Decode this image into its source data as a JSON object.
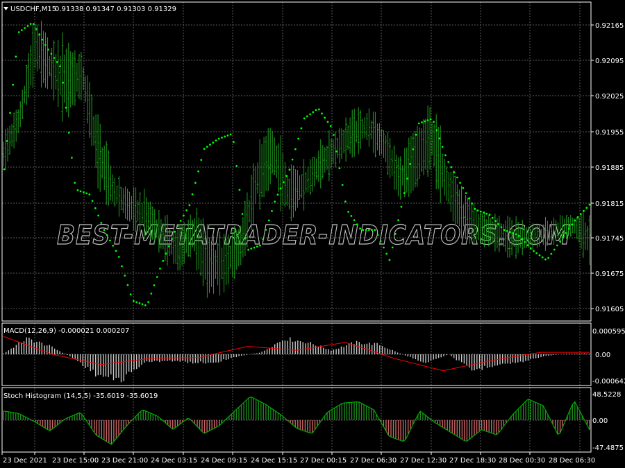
{
  "symbol_label": "USDCHF,M15",
  "ohlc_label": "0.91338 0.91347 0.91303 0.91329",
  "watermark": "BEST-METATRADER-INDICATORS.COM",
  "colors": {
    "background": "#000000",
    "grid": "#5a5a5a",
    "frame": "#ffffff",
    "candle": "#1fa31f",
    "sar": "#00ff00",
    "macd_hist": "#c8c8c8",
    "macd_signal": "#ff0000",
    "stoch_pos": "#1a8a1a",
    "stoch_neg": "#c86464",
    "stoch_line": "#00aa00"
  },
  "icons": {
    "symbol_dropdown": "triangle-down-icon"
  },
  "price_axis": [
    "0.92165",
    "0.92095",
    "0.92025",
    "0.91955",
    "0.91885",
    "0.91815",
    "0.91745",
    "0.91675",
    "0.91605"
  ],
  "macd": {
    "label": "MACD(12,26,9) -0.000021 0.000207",
    "axis": [
      "0.000595",
      "0.00",
      "-0.000642"
    ]
  },
  "stoch": {
    "label": "Stoch Histogram (14,5,5) -35.6019 -35.6019",
    "axis": [
      "48.5228",
      "0.00",
      "-47.4875"
    ]
  },
  "time_axis": [
    "23 Dec 2021",
    "23 Dec 15:00",
    "23 Dec 21:00",
    "24 Dec 03:15",
    "24 Dec 09:15",
    "24 Dec 15:15",
    "27 Dec 00:15",
    "27 Dec 06:30",
    "27 Dec 12:30",
    "27 Dec 18:30",
    "28 Dec 00:30",
    "28 Dec 06:30"
  ],
  "chart_data": {
    "type": "line",
    "price_key": [
      [
        0.9188,
        0.9194
      ],
      [
        0.9196,
        0.92
      ],
      [
        0.9208,
        0.9217
      ],
      [
        0.9205,
        0.9211
      ],
      [
        0.9199,
        0.9212
      ],
      [
        0.9204,
        0.9209
      ],
      [
        0.9186,
        0.9196
      ],
      [
        0.9181,
        0.9186
      ],
      [
        0.9178,
        0.9183
      ],
      [
        0.9176,
        0.9182
      ],
      [
        0.9172,
        0.9178
      ],
      [
        0.9169,
        0.9175
      ],
      [
        0.9172,
        0.9179
      ],
      [
        0.9164,
        0.9174
      ],
      [
        0.9166,
        0.9173
      ],
      [
        0.917,
        0.9176
      ],
      [
        0.9182,
        0.919
      ],
      [
        0.9187,
        0.9196
      ],
      [
        0.9178,
        0.9188
      ],
      [
        0.9182,
        0.9188
      ],
      [
        0.9186,
        0.9192
      ],
      [
        0.9189,
        0.9195
      ],
      [
        0.9192,
        0.9198
      ],
      [
        0.9194,
        0.9199
      ],
      [
        0.919,
        0.9196
      ],
      [
        0.9183,
        0.9189
      ],
      [
        0.9186,
        0.9194
      ],
      [
        0.919,
        0.9199
      ],
      [
        0.918,
        0.919
      ],
      [
        0.9176,
        0.9182
      ],
      [
        0.9174,
        0.9179
      ],
      [
        0.9173,
        0.9178
      ],
      [
        0.9172,
        0.9177
      ],
      [
        0.9172,
        0.9177
      ],
      [
        0.9173,
        0.9177
      ],
      [
        0.9174,
        0.9178
      ],
      [
        0.9175,
        0.9179
      ],
      [
        0.917,
        0.9178
      ]
    ],
    "sar_key": [
      [
        0.9188,
        0.9215
      ],
      [
        0.9217,
        0.9212
      ],
      [
        0.9208,
        0.9184
      ],
      [
        0.9183,
        0.9176
      ],
      [
        0.9171,
        0.9162
      ],
      [
        0.9161,
        0.9169
      ],
      [
        0.9176,
        0.9181
      ],
      [
        0.9192,
        0.9194
      ],
      [
        0.9195,
        0.9172
      ],
      [
        0.9173,
        0.9182
      ],
      [
        0.9188,
        0.9198
      ],
      [
        0.92,
        0.9196
      ],
      [
        0.918,
        0.9176
      ],
      [
        0.9176,
        0.917
      ],
      [
        0.9183,
        0.9197
      ],
      [
        0.9198,
        0.919
      ],
      [
        0.9185,
        0.918
      ],
      [
        0.9179,
        0.9176
      ],
      [
        0.9175,
        0.9172
      ],
      [
        0.917,
        0.9174
      ],
      [
        0.9178,
        0.9181
      ]
    ],
    "macd_key": [
      [
        2e-05,
        0.0004,
        0.00045
      ],
      [
        0.0002,
        -0.0001,
        0.0
      ],
      [
        -0.0005,
        -0.00063,
        -0.00025
      ],
      [
        -0.0002,
        -0.00015,
        -0.0001
      ],
      [
        -0.0002,
        -0.0002,
        -8e-05
      ],
      [
        -5e-05,
        5e-05,
        0.0002
      ],
      [
        0.0004,
        0.0003,
        0.0001
      ],
      [
        0.0001,
        0.0003,
        0.0003
      ],
      [
        0.00025,
        0.0,
        -0.0001
      ],
      [
        -0.0002,
        0.0,
        -0.0004
      ],
      [
        -0.0004,
        -0.00025,
        -0.00015
      ],
      [
        -0.0002,
        -5e-05,
        5e-05
      ],
      [
        2e-05,
        2e-05,
        5e-05
      ]
    ],
    "stoch_key": [
      [
        0.35,
        0.25,
        -0.05
      ],
      [
        -0.4,
        0.05,
        0.3
      ],
      [
        -0.55,
        -0.9,
        -0.2
      ],
      [
        0.4,
        0.15,
        -0.35
      ],
      [
        0.1,
        -0.5,
        -0.2
      ],
      [
        0.35,
        0.9,
        0.6
      ],
      [
        0.2,
        -0.3,
        -0.5
      ],
      [
        0.3,
        0.65,
        0.7
      ],
      [
        0.4,
        -0.6,
        -0.8
      ],
      [
        0.35,
        -0.1,
        -0.45
      ],
      [
        -0.8,
        -0.35,
        -0.55
      ],
      [
        0.2,
        0.8,
        0.55
      ],
      [
        -0.6,
        0.75,
        -0.36
      ]
    ]
  }
}
